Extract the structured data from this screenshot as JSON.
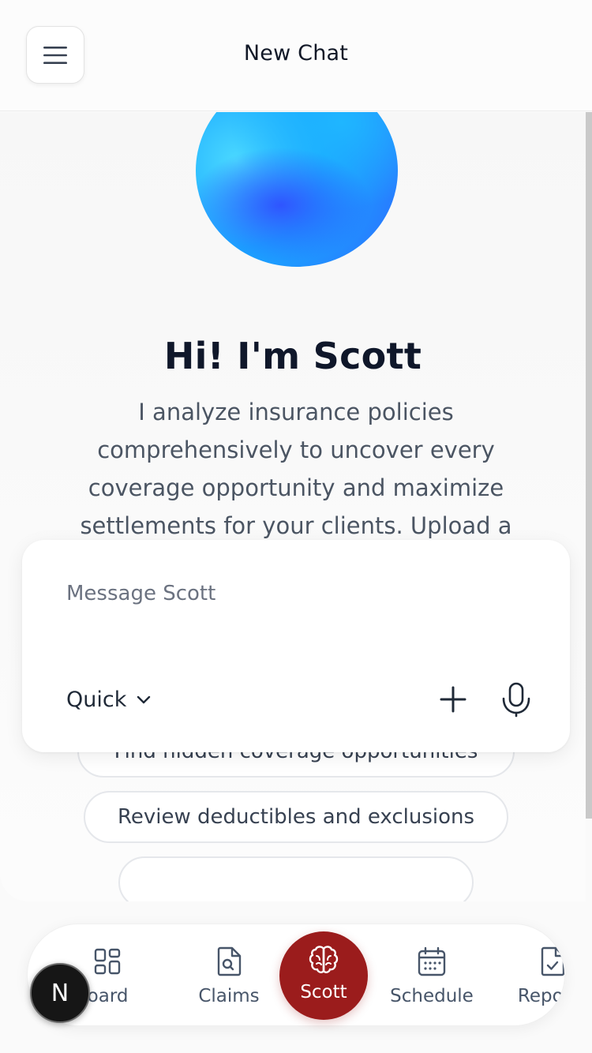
{
  "header": {
    "title": "New Chat",
    "menu_icon": "hamburger-menu-icon"
  },
  "hero": {
    "greeting": "Hi! I'm Scott",
    "intro": "I analyze insurance policies comprehensively to uncover every coverage opportunity and maximize settlements for your clients. Upload a"
  },
  "suggestions": [
    {
      "label": "Find hidden coverage opportunities"
    },
    {
      "label": "Review deductibles and exclusions"
    },
    {
      "label": ""
    }
  ],
  "composer": {
    "placeholder": "Message Scott",
    "mode": "Quick",
    "attach_icon": "plus-icon",
    "voice_icon": "microphone-icon"
  },
  "nav": {
    "dashboard": {
      "label": "Dashboard",
      "visible_label": "hboard",
      "icon": "grid-icon"
    },
    "claims": {
      "label": "Claims",
      "icon": "file-search-icon"
    },
    "scott": {
      "label": "Scott",
      "icon": "brain-icon",
      "active": true
    },
    "schedule": {
      "label": "Schedule",
      "icon": "calendar-icon"
    },
    "reports": {
      "label": "Reports",
      "icon": "file-check-icon"
    }
  },
  "badge": {
    "letter": "N"
  },
  "colors": {
    "accent": "#9b1c1c",
    "text_primary": "#0f172a",
    "text_secondary": "#4b5563",
    "nav_text": "#475569"
  }
}
